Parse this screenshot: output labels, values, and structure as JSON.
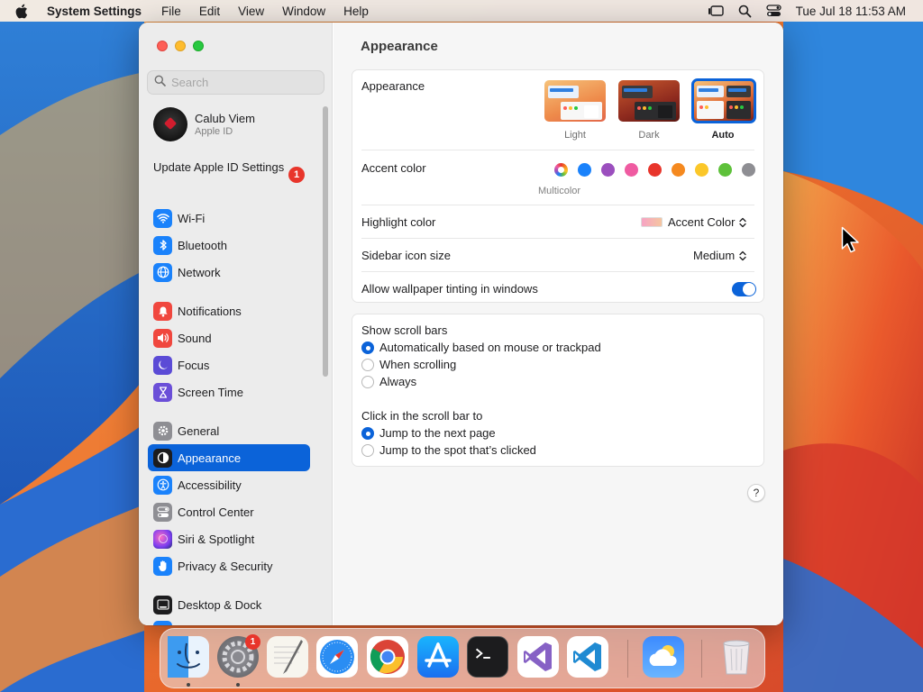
{
  "menubar": {
    "app_name": "System Settings",
    "menus": [
      "File",
      "Edit",
      "View",
      "Window",
      "Help"
    ],
    "clock": "Tue Jul 18  11:53 AM"
  },
  "sidebar": {
    "search_placeholder": "Search",
    "profile": {
      "name": "Calub Viem",
      "subtitle": "Apple ID"
    },
    "update": {
      "label": "Update Apple ID Settings",
      "badge": "1"
    },
    "items": [
      {
        "label": "Wi-Fi",
        "icon": "wifi-icon",
        "color": "#1a82fb"
      },
      {
        "label": "Bluetooth",
        "icon": "bluetooth-icon",
        "color": "#1a82fb"
      },
      {
        "label": "Network",
        "icon": "globe-icon",
        "color": "#1a82fb"
      },
      {
        "label": "Notifications",
        "icon": "bell-icon",
        "color": "#f0473e"
      },
      {
        "label": "Sound",
        "icon": "speaker-icon",
        "color": "#f0473e"
      },
      {
        "label": "Focus",
        "icon": "moon-icon",
        "color": "#5b4bd6"
      },
      {
        "label": "Screen Time",
        "icon": "hourglass-icon",
        "color": "#6b4fd8"
      },
      {
        "label": "General",
        "icon": "gear-icon",
        "color": "#8e8e93"
      },
      {
        "label": "Appearance",
        "icon": "appearance-icon",
        "color": "#1c1c1e"
      },
      {
        "label": "Accessibility",
        "icon": "accessibility-icon",
        "color": "#1a82fb"
      },
      {
        "label": "Control Center",
        "icon": "control-center-icon",
        "color": "#8e8e93"
      },
      {
        "label": "Siri & Spotlight",
        "icon": "siri-icon",
        "color": "#c02bd0"
      },
      {
        "label": "Privacy & Security",
        "icon": "hand-icon",
        "color": "#1a82fb"
      },
      {
        "label": "Desktop & Dock",
        "icon": "desktop-icon",
        "color": "#1c1c1e"
      }
    ],
    "active_item": "Appearance"
  },
  "content": {
    "title": "Appearance",
    "appearance": {
      "label": "Appearance",
      "options": [
        {
          "label": "Light",
          "selected": false
        },
        {
          "label": "Dark",
          "selected": false
        },
        {
          "label": "Auto",
          "selected": true
        }
      ]
    },
    "accent_color": {
      "label": "Accent color",
      "selected_label": "Multicolor",
      "swatches": [
        "#multicolor",
        "#1a82fb",
        "#9b4fbe",
        "#ef5ba1",
        "#e8352b",
        "#f5891f",
        "#fbc729",
        "#5ec13a",
        "#8e8e93"
      ]
    },
    "highlight_color": {
      "label": "Highlight color",
      "value": "Accent Color"
    },
    "sidebar_icon_size": {
      "label": "Sidebar icon size",
      "value": "Medium"
    },
    "wallpaper_tinting": {
      "label": "Allow wallpaper tinting in windows",
      "enabled": true
    },
    "scroll_bars": {
      "label": "Show scroll bars",
      "options": [
        "Automatically based on mouse or trackpad",
        "When scrolling",
        "Always"
      ],
      "selected_index": 0
    },
    "scroll_click": {
      "label": "Click in the scroll bar to",
      "options": [
        "Jump to the next page",
        "Jump to the spot that’s clicked"
      ],
      "selected_index": 0
    },
    "help_label": "?"
  },
  "dock": {
    "apps": [
      "Finder",
      "System Settings",
      "TextEdit",
      "Safari",
      "Chrome",
      "App Store",
      "Terminal",
      "Visual Studio",
      "Visual Studio Code",
      "Weather",
      "Trash"
    ],
    "settings_badge": "1"
  }
}
